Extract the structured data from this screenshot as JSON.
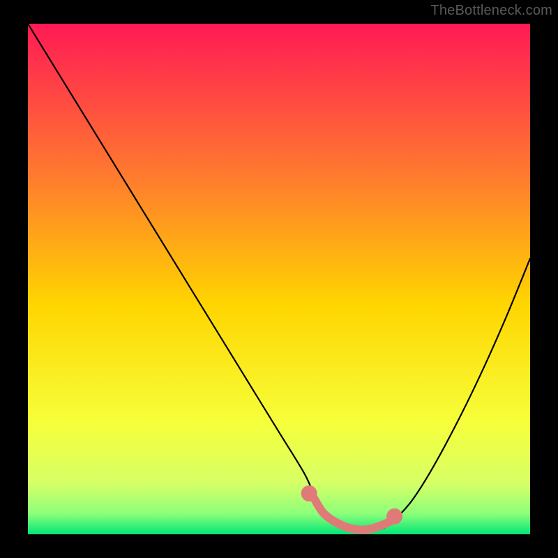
{
  "watermark": "TheBottleneck.com",
  "chart_data": {
    "type": "line",
    "title": "",
    "xlabel": "",
    "ylabel": "",
    "xlim": [
      0,
      100
    ],
    "ylim": [
      0,
      100
    ],
    "grid": false,
    "legend": false,
    "background_gradient": {
      "stops": [
        {
          "offset": 0.0,
          "color": "#ff1a55"
        },
        {
          "offset": 0.3,
          "color": "#ff7b2e"
        },
        {
          "offset": 0.55,
          "color": "#ffd500"
        },
        {
          "offset": 0.78,
          "color": "#f6ff3a"
        },
        {
          "offset": 0.9,
          "color": "#d6ff66"
        },
        {
          "offset": 0.96,
          "color": "#8cff7a"
        },
        {
          "offset": 1.0,
          "color": "#00e676"
        }
      ]
    },
    "series": [
      {
        "name": "bottleneck-curve",
        "color": "#000000",
        "x": [
          0,
          5,
          10,
          15,
          20,
          25,
          30,
          35,
          40,
          45,
          50,
          55,
          58,
          62,
          66,
          70,
          72,
          76,
          80,
          85,
          90,
          95,
          100
        ],
        "values": [
          100,
          92,
          84,
          76,
          68,
          60,
          52,
          44,
          36,
          28,
          20,
          12,
          6,
          2,
          1,
          1,
          2,
          6,
          12,
          21,
          31,
          42,
          54
        ]
      },
      {
        "name": "highlight-segment",
        "color": "#e07a78",
        "thick": true,
        "x": [
          57,
          59,
          62,
          65,
          68,
          71,
          73
        ],
        "values": [
          7,
          4,
          2,
          1,
          1,
          2,
          3
        ]
      }
    ],
    "markers": [
      {
        "name": "dot-left",
        "x": 56,
        "y": 8,
        "color": "#e07a78",
        "r": 1.6
      },
      {
        "name": "dot-right",
        "x": 73,
        "y": 3.5,
        "color": "#e07a78",
        "r": 1.6
      }
    ]
  }
}
